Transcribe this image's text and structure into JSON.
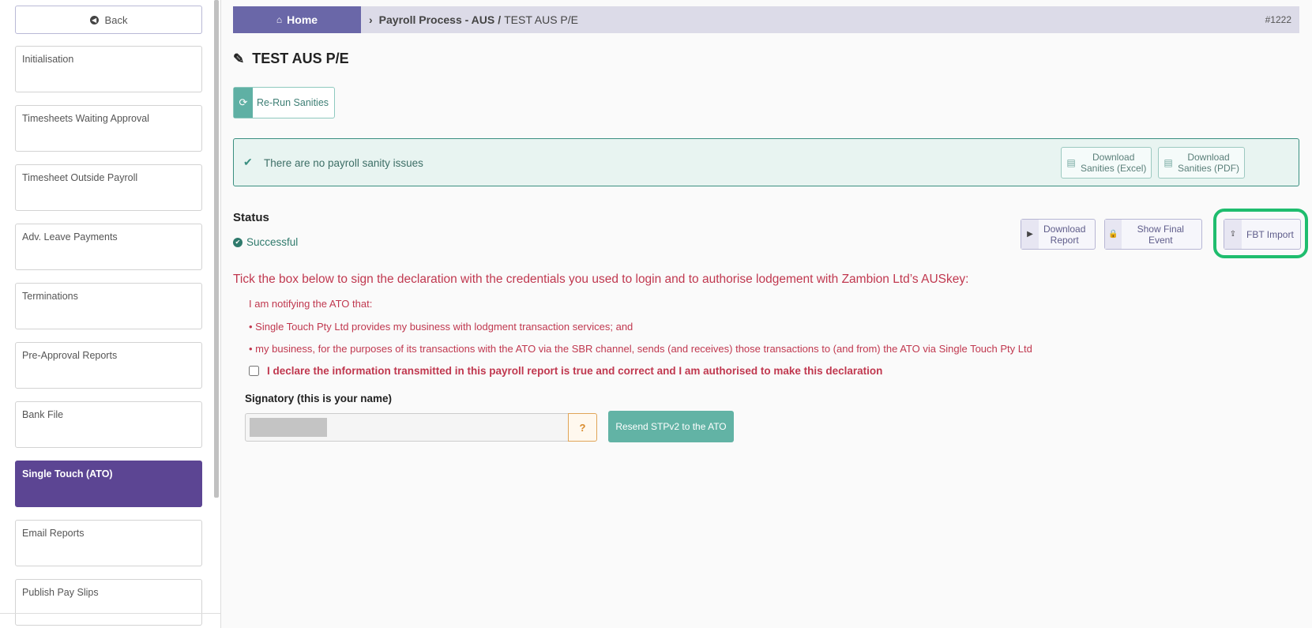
{
  "sidebar": {
    "back_label": "Back",
    "items": [
      {
        "label": "Initialisation",
        "active": false
      },
      {
        "label": "Timesheets Waiting Approval",
        "active": false
      },
      {
        "label": "Timesheet Outside Payroll",
        "active": false
      },
      {
        "label": "Adv. Leave Payments",
        "active": false
      },
      {
        "label": "Terminations",
        "active": false
      },
      {
        "label": "Pre-Approval Reports",
        "active": false
      },
      {
        "label": "Bank File",
        "active": false
      },
      {
        "label": "Single Touch (ATO)",
        "active": true
      },
      {
        "label": "Email Reports",
        "active": false
      },
      {
        "label": "Publish Pay Slips",
        "active": false
      }
    ]
  },
  "breadcrumb": {
    "home_label": "Home",
    "parent": "Payroll Process - AUS",
    "separator": "/",
    "current": "TEST AUS P/E",
    "id": "#1222"
  },
  "page": {
    "title": "TEST AUS P/E",
    "rerun_label": "Re-Run Sanities"
  },
  "sanity": {
    "message": "There are no payroll sanity issues",
    "excel_line1": "Download",
    "excel_line2": "Sanities (Excel)",
    "pdf_line1": "Download",
    "pdf_line2": "Sanities (PDF)"
  },
  "status": {
    "heading": "Status",
    "value": "Successful"
  },
  "actions": {
    "download_report_line1": "Download",
    "download_report_line2": "Report",
    "show_final_event": "Show Final Event",
    "fbt_import": "FBT Import"
  },
  "declaration": {
    "heading": "Tick the box below to sign the declaration with the credentials you used to login and to authorise lodgement with Zambion Ltd’s AUSkey:",
    "line1": "I am notifying the ATO that:",
    "line2": "• Single Touch Pty Ltd provides my business with lodgment transaction services; and",
    "line3": "• my business, for the purposes of its transactions with the ATO via the SBR channel, sends (and receives) those transactions to (and from) the ATO via Single Touch Pty Ltd",
    "checkbox_label": "I declare the information transmitted in this payroll report is true and correct and I am authorised to make this declaration"
  },
  "signatory": {
    "label": "Signatory (this is your name)",
    "help": "?",
    "resend_label": "Resend STPv2 to the ATO"
  },
  "colors": {
    "nav_active": "#5c4593",
    "home_button": "#6a67a8",
    "declaration_text": "#c0384f",
    "success": "#2f7a6c",
    "highlight_ring": "#1fbd6e"
  }
}
